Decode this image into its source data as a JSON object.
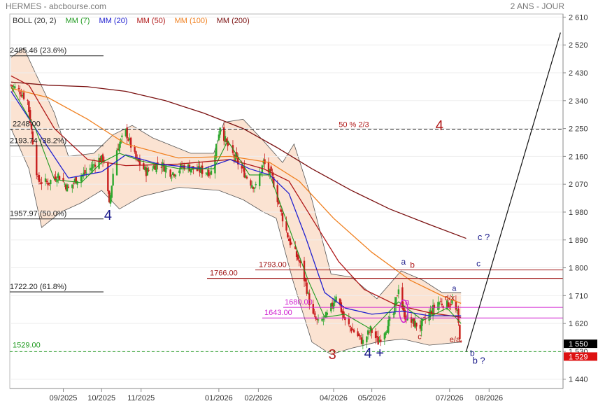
{
  "header": {
    "source": "HERMES - abcbourse.com",
    "period": "2 ANS - JOUR"
  },
  "legend": [
    {
      "label": "BOLL (20, 2)",
      "color": "#333333"
    },
    {
      "label": "MM (7)",
      "color": "#1f9a1f"
    },
    {
      "label": "MM (20)",
      "color": "#2020d0"
    },
    {
      "label": "MM (50)",
      "color": "#b01818"
    },
    {
      "label": "MM (100)",
      "color": "#f08020"
    },
    {
      "label": "MM (200)",
      "color": "#7a1010"
    }
  ],
  "colors": {
    "mm7": "#1f9a1f",
    "mm20": "#2020d0",
    "mm50": "#b01818",
    "mm100": "#f08020",
    "mm200": "#7a1010",
    "boll_fill": "#fbe3d2",
    "boll_line": "#555555",
    "up": "#2ea82e",
    "down": "#c81e1e",
    "wave_red": "#b01818",
    "wave_blue": "#1a1a8a",
    "magenta": "#d020d0",
    "green": "#1f9a1f"
  },
  "chart_data": {
    "type": "candlestick",
    "y_axis": {
      "min": 1410,
      "max": 2620,
      "ticks": [
        2610,
        2520,
        2430,
        2340,
        2250,
        2160,
        2070,
        1980,
        1890,
        1800,
        1710,
        1620,
        1530,
        1440
      ],
      "tick_labels": [
        "2 610",
        "2 520",
        "2 430",
        "2 340",
        "2 250",
        "2 160",
        "2 070",
        "1 980",
        "1 890",
        "1 800",
        "1 710",
        "1 620",
        "1 530",
        "1 440"
      ]
    },
    "x_axis": {
      "range": [
        "2025-07-21",
        "2026-09-28"
      ],
      "ticks": [
        "2025-09-01",
        "2025-10-01",
        "2025-11-01",
        "2026-01-01",
        "2026-02-01",
        "2026-04-01",
        "2026-05-01",
        "2026-07-01",
        "2026-08-01"
      ],
      "tick_labels": [
        "09/2025",
        "10/2025",
        "11/2025",
        "01/2026",
        "02/2026",
        "04/2026",
        "05/2026",
        "07/2026",
        "08/2026"
      ]
    },
    "close_path": [
      [
        "2025-07-22",
        2390
      ],
      [
        "2025-07-29",
        2370
      ],
      [
        "2025-08-04",
        2340
      ],
      [
        "2025-08-08",
        2210
      ],
      [
        "2025-08-12",
        2080
      ],
      [
        "2025-08-20",
        2075
      ],
      [
        "2025-08-28",
        2100
      ],
      [
        "2025-09-05",
        2055
      ],
      [
        "2025-09-12",
        2090
      ],
      [
        "2025-09-20",
        2110
      ],
      [
        "2025-09-28",
        2150
      ],
      [
        "2025-10-03",
        2150
      ],
      [
        "2025-10-07",
        2000
      ],
      [
        "2025-10-12",
        2175
      ],
      [
        "2025-10-20",
        2240
      ],
      [
        "2025-10-28",
        2150
      ],
      [
        "2025-11-05",
        2110
      ],
      [
        "2025-11-15",
        2140
      ],
      [
        "2025-11-25",
        2105
      ],
      [
        "2025-12-05",
        2130
      ],
      [
        "2025-12-15",
        2115
      ],
      [
        "2025-12-26",
        2110
      ],
      [
        "2026-01-02",
        2260
      ],
      [
        "2026-01-07",
        2200
      ],
      [
        "2026-01-15",
        2145
      ],
      [
        "2026-01-25",
        2080
      ],
      [
        "2026-01-30",
        2060
      ],
      [
        "2026-02-05",
        2140
      ],
      [
        "2026-02-12",
        2090
      ],
      [
        "2026-02-18",
        1990
      ],
      [
        "2026-02-25",
        1890
      ],
      [
        "2026-03-05",
        1820
      ],
      [
        "2026-03-10",
        1750
      ],
      [
        "2026-03-15",
        1650
      ],
      [
        "2026-03-20",
        1620
      ],
      [
        "2026-03-28",
        1650
      ],
      [
        "2026-04-03",
        1715
      ],
      [
        "2026-04-10",
        1625
      ],
      [
        "2026-04-18",
        1590
      ],
      [
        "2026-04-24",
        1560
      ],
      [
        "2026-04-30",
        1600
      ],
      [
        "2026-05-06",
        1560
      ],
      [
        "2026-05-12",
        1605
      ],
      [
        "2026-05-18",
        1650
      ],
      [
        "2026-05-22",
        1740
      ],
      [
        "2026-05-26",
        1650
      ],
      [
        "2026-06-01",
        1625
      ],
      [
        "2026-06-08",
        1610
      ],
      [
        "2026-06-15",
        1650
      ],
      [
        "2026-06-22",
        1690
      ],
      [
        "2026-06-29",
        1680
      ],
      [
        "2026-07-03",
        1690
      ],
      [
        "2026-07-07",
        1650
      ],
      [
        "2026-07-10",
        1550
      ]
    ],
    "mm7": [
      [
        "2025-07-22",
        2385
      ],
      [
        "2025-08-10",
        2250
      ],
      [
        "2025-08-25",
        2085
      ],
      [
        "2025-09-15",
        2075
      ],
      [
        "2025-10-01",
        2140
      ],
      [
        "2025-10-15",
        2170
      ],
      [
        "2025-11-01",
        2145
      ],
      [
        "2025-12-01",
        2120
      ],
      [
        "2025-12-28",
        2120
      ],
      [
        "2026-01-08",
        2210
      ],
      [
        "2026-01-25",
        2100
      ],
      [
        "2026-02-10",
        2100
      ],
      [
        "2026-02-25",
        1930
      ],
      [
        "2026-03-12",
        1760
      ],
      [
        "2026-03-25",
        1640
      ],
      [
        "2026-04-10",
        1650
      ],
      [
        "2026-05-01",
        1600
      ],
      [
        "2026-05-22",
        1690
      ],
      [
        "2026-06-10",
        1630
      ],
      [
        "2026-06-29",
        1670
      ],
      [
        "2026-07-10",
        1620
      ]
    ],
    "mm20": [
      [
        "2025-07-22",
        2370
      ],
      [
        "2025-08-15",
        2220
      ],
      [
        "2025-09-05",
        2090
      ],
      [
        "2025-10-01",
        2110
      ],
      [
        "2025-10-20",
        2165
      ],
      [
        "2025-11-15",
        2135
      ],
      [
        "2025-12-20",
        2120
      ],
      [
        "2026-01-10",
        2150
      ],
      [
        "2026-01-25",
        2120
      ],
      [
        "2026-02-10",
        2100
      ],
      [
        "2026-02-25",
        2040
      ],
      [
        "2026-03-10",
        1900
      ],
      [
        "2026-03-25",
        1720
      ],
      [
        "2026-04-10",
        1670
      ],
      [
        "2026-05-01",
        1650
      ],
      [
        "2026-05-25",
        1660
      ],
      [
        "2026-06-15",
        1645
      ],
      [
        "2026-07-10",
        1645
      ]
    ],
    "mm50": [
      [
        "2025-07-22",
        2420
      ],
      [
        "2025-08-05",
        2390
      ],
      [
        "2025-08-25",
        2250
      ],
      [
        "2025-09-20",
        2150
      ],
      [
        "2025-10-20",
        2130
      ],
      [
        "2025-11-30",
        2135
      ],
      [
        "2026-01-10",
        2150
      ],
      [
        "2026-02-05",
        2120
      ],
      [
        "2026-02-25",
        2080
      ],
      [
        "2026-03-15",
        1960
      ],
      [
        "2026-04-05",
        1820
      ],
      [
        "2026-04-25",
        1730
      ],
      [
        "2026-05-20",
        1680
      ],
      [
        "2026-06-15",
        1655
      ],
      [
        "2026-07-10",
        1640
      ]
    ],
    "mm100": [
      [
        "2025-07-22",
        2380
      ],
      [
        "2025-08-20",
        2350
      ],
      [
        "2025-09-20",
        2280
      ],
      [
        "2025-10-20",
        2200
      ],
      [
        "2025-11-30",
        2155
      ],
      [
        "2026-01-10",
        2160
      ],
      [
        "2026-02-10",
        2140
      ],
      [
        "2026-03-05",
        2080
      ],
      [
        "2026-04-01",
        1960
      ],
      [
        "2026-05-01",
        1850
      ],
      [
        "2026-05-31",
        1760
      ],
      [
        "2026-06-25",
        1710
      ],
      [
        "2026-07-10",
        1685
      ]
    ],
    "mm200": [
      [
        "2025-07-22",
        2400
      ],
      [
        "2025-08-20",
        2390
      ],
      [
        "2025-09-20",
        2385
      ],
      [
        "2025-10-20",
        2370
      ],
      [
        "2025-11-20",
        2340
      ],
      [
        "2025-12-20",
        2300
      ],
      [
        "2026-01-20",
        2250
      ],
      [
        "2026-02-15",
        2190
      ],
      [
        "2026-03-15",
        2120
      ],
      [
        "2026-04-15",
        2050
      ],
      [
        "2026-05-15",
        1990
      ],
      [
        "2026-06-15",
        1940
      ],
      [
        "2026-07-14",
        1895
      ]
    ],
    "boll_upper": [
      [
        "2025-07-22",
        2480
      ],
      [
        "2025-08-01",
        2510
      ],
      [
        "2025-08-10",
        2430
      ],
      [
        "2025-08-25",
        2300
      ],
      [
        "2025-09-05",
        2160
      ],
      [
        "2025-09-25",
        2170
      ],
      [
        "2025-10-10",
        2230
      ],
      [
        "2025-10-25",
        2260
      ],
      [
        "2025-11-10",
        2220
      ],
      [
        "2025-12-10",
        2170
      ],
      [
        "2025-12-28",
        2170
      ],
      [
        "2026-01-05",
        2270
      ],
      [
        "2026-01-20",
        2280
      ],
      [
        "2026-02-05",
        2210
      ],
      [
        "2026-02-20",
        2140
      ],
      [
        "2026-03-01",
        2200
      ],
      [
        "2026-03-15",
        2020
      ],
      [
        "2026-03-30",
        1780
      ],
      [
        "2026-04-15",
        1770
      ],
      [
        "2026-05-05",
        1700
      ],
      [
        "2026-05-24",
        1790
      ],
      [
        "2026-06-10",
        1760
      ],
      [
        "2026-06-25",
        1720
      ],
      [
        "2026-07-10",
        1720
      ]
    ],
    "boll_lower": [
      [
        "2025-07-22",
        2250
      ],
      [
        "2025-08-05",
        2120
      ],
      [
        "2025-08-15",
        1930
      ],
      [
        "2025-08-30",
        1980
      ],
      [
        "2025-09-15",
        2010
      ],
      [
        "2025-10-01",
        2050
      ],
      [
        "2025-10-15",
        1990
      ],
      [
        "2025-11-01",
        2030
      ],
      [
        "2025-12-01",
        2060
      ],
      [
        "2026-01-01",
        2050
      ],
      [
        "2026-01-20",
        2020
      ],
      [
        "2026-02-05",
        1980
      ],
      [
        "2026-02-15",
        1960
      ],
      [
        "2026-02-28",
        1760
      ],
      [
        "2026-03-15",
        1560
      ],
      [
        "2026-03-30",
        1520
      ],
      [
        "2026-04-15",
        1540
      ],
      [
        "2026-05-05",
        1560
      ],
      [
        "2026-05-25",
        1570
      ],
      [
        "2026-06-15",
        1550
      ],
      [
        "2026-07-10",
        1560
      ]
    ],
    "price_tags": [
      {
        "label": "1 550",
        "value": 1550,
        "bg": "#000000"
      },
      {
        "label": "1 529",
        "value": 1529,
        "bg": "#dd1111"
      }
    ]
  },
  "fib_levels": [
    {
      "label": "2485.46  (23.6%)",
      "value": 2485
    },
    {
      "label": "2193.74  (38.2%)",
      "value": 2194
    },
    {
      "label": "1957.97  (50.0%)",
      "value": 1958
    },
    {
      "label": "1722.20  (61.8%)",
      "value": 1722
    }
  ],
  "horizontal_levels": [
    {
      "label": "2248.00",
      "value": 2248,
      "color": "#222222",
      "style": "dashed"
    },
    {
      "label": "1793.00",
      "value": 1793,
      "color": "#a01818",
      "style": "solid"
    },
    {
      "label": "1766.00",
      "value": 1766,
      "color": "#a01818",
      "style": "solid"
    },
    {
      "label": "1680.00",
      "value": 1672,
      "color": "#d020d0",
      "style": "solid"
    },
    {
      "label": "1643.00",
      "value": 1638,
      "color": "#d020d0",
      "style": "solid"
    },
    {
      "label": "1529.00",
      "value": 1529,
      "color": "#1f9a1f",
      "style": "dashed"
    }
  ],
  "annotations": [
    {
      "text": "50 % 2/3",
      "date": "2026-04-05",
      "value": 2255,
      "color": "#b01818",
      "size": 11
    },
    {
      "text": "4",
      "date": "2025-10-03",
      "value": 1955,
      "color": "#1a1a8a",
      "size": 20
    },
    {
      "text": "4",
      "date": "2026-06-20",
      "value": 2245,
      "color": "#b01818",
      "size": 20
    },
    {
      "text": "3",
      "date": "2026-03-28",
      "value": 1505,
      "color": "#b01818",
      "size": 20
    },
    {
      "text": "4 +",
      "date": "2026-04-25",
      "value": 1510,
      "color": "#1a1a8a",
      "size": 20
    },
    {
      "text": "a",
      "date": "2026-05-24",
      "value": 1810,
      "color": "#1a1a8a",
      "size": 12
    },
    {
      "text": "b",
      "date": "2026-05-31",
      "value": 1800,
      "color": "#b01818",
      "size": 12
    },
    {
      "text": "a",
      "date": "2026-05-27",
      "value": 1680,
      "color": "#d020d0",
      "size": 12
    },
    {
      "text": "c",
      "date": "2026-06-06",
      "value": 1570,
      "color": "#b01818",
      "size": 11
    },
    {
      "text": "d/x",
      "date": "2026-06-27",
      "value": 1695,
      "color": "#b01818",
      "size": 11
    },
    {
      "text": "a",
      "date": "2026-07-03",
      "value": 1725,
      "color": "#1a1a8a",
      "size": 11
    },
    {
      "text": "e/a",
      "date": "2026-07-01",
      "value": 1560,
      "color": "#b01818",
      "size": 11
    },
    {
      "text": "c ?",
      "date": "2026-07-23",
      "value": 1890,
      "color": "#1a1a8a",
      "size": 13
    },
    {
      "text": "c",
      "date": "2026-07-22",
      "value": 1805,
      "color": "#1a1a8a",
      "size": 12
    },
    {
      "text": "b",
      "date": "2026-07-17",
      "value": 1515,
      "color": "#1a1a8a",
      "size": 12
    },
    {
      "text": "b ?",
      "date": "2026-07-19",
      "value": 1490,
      "color": "#1a1a8a",
      "size": 13
    }
  ],
  "projection": [
    [
      "2026-07-14",
      1529
    ],
    [
      "2026-09-26",
      2560
    ]
  ]
}
